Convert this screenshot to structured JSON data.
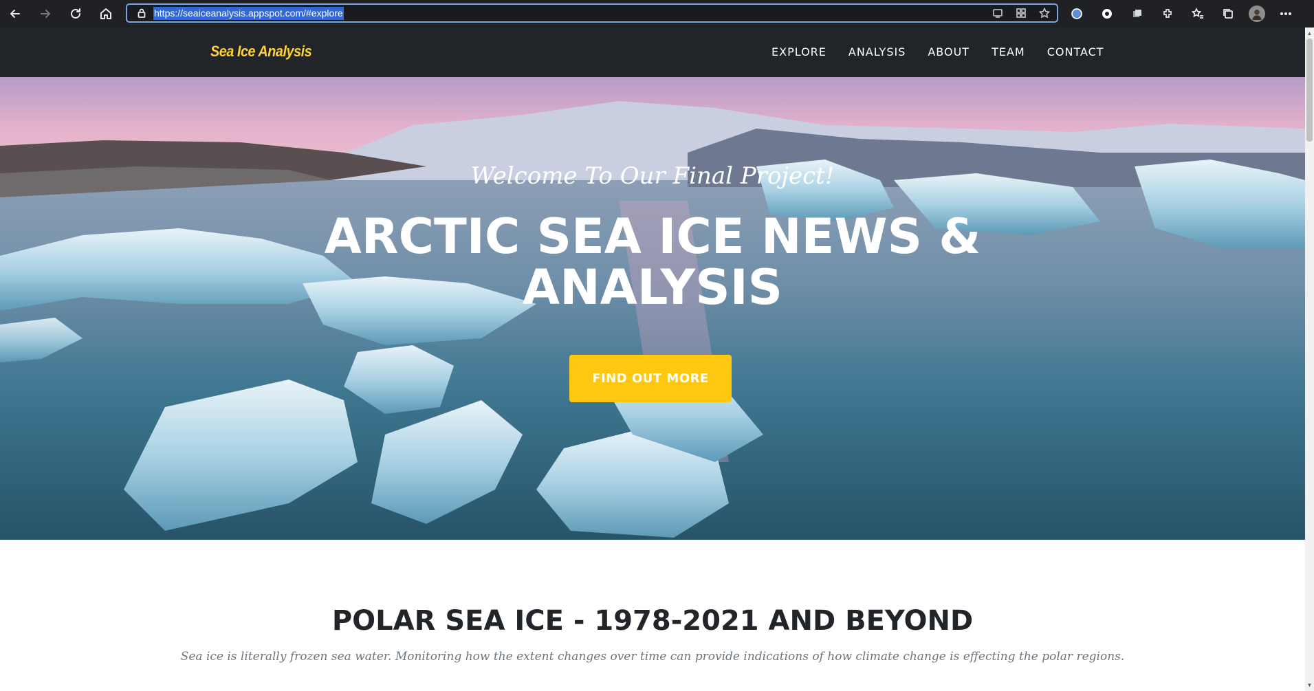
{
  "browser": {
    "url": "https://seaiceanalysis.appspot.com/#explore",
    "nav_icons": [
      "back-icon",
      "forward-icon",
      "reload-icon",
      "home-icon"
    ],
    "omnibox_icons": [
      "reader-mode-icon",
      "app-available-icon",
      "add-favorite-icon"
    ],
    "toolbar_icons": [
      "extension-1-icon",
      "extension-2-icon",
      "extension-3-icon",
      "extensions-icon",
      "favorites-icon",
      "collections-icon",
      "profile-avatar",
      "more-menu-icon"
    ],
    "accent": "#7aa9e0"
  },
  "site": {
    "brand": "Sea Ice Analysis",
    "brand_color": "#fed136",
    "nav_bg": "#212529",
    "menu": [
      "EXPLORE",
      "ANALYSIS",
      "ABOUT",
      "TEAM",
      "CONTACT"
    ]
  },
  "hero": {
    "subtitle": "Welcome To Our Final Project!",
    "title_line1": "ARCTIC SEA ICE NEWS &",
    "title_line2": "ANALYSIS",
    "button": "FIND OUT MORE",
    "button_color": "#fec810"
  },
  "section": {
    "title": "POLAR SEA ICE - 1978-2021 AND BEYOND",
    "subtitle": "Sea ice is literally frozen sea water. Monitoring how the extent changes over time can provide indications of how climate change is effecting the polar regions."
  }
}
